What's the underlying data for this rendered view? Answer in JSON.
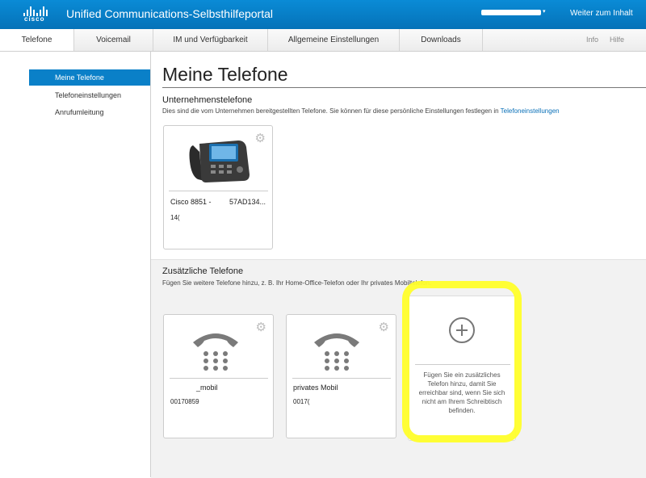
{
  "header": {
    "brand": "cisco",
    "title": "Unified Communications-Selbsthilfeportal",
    "user_caret": "▾",
    "skip_link": "Weiter zum Inhalt"
  },
  "tabs": [
    "Telefone",
    "Voicemail",
    "IM und Verfügbarkeit",
    "Allgemeine Einstellungen",
    "Downloads"
  ],
  "top_links": {
    "info": "Info",
    "help": "Hilfe"
  },
  "sidebar": {
    "items": [
      "Meine Telefone",
      "Telefoneinstellungen",
      "Anrufumleitung"
    ]
  },
  "main": {
    "title": "Meine Telefone",
    "company_section": {
      "title": "Unternehmenstelefone",
      "description": "Dies sind die vom Unternehmen bereitgestellten Telefone. Sie können für diese persönliche Einstellungen festlegen in",
      "link": "Telefoneinstellungen",
      "phones": [
        {
          "name": "Cisco 8851 -",
          "name_suffix": "57AD134...",
          "number": "14("
        }
      ]
    },
    "additional_section": {
      "title": "Zusätzliche Telefone",
      "description": "Fügen Sie weitere Telefone hinzu, z. B. Ihr Home-Office-Telefon oder Ihr privates Mobiltelefon.",
      "phones": [
        {
          "name": "_mobil",
          "number": "00170859"
        },
        {
          "name": "privates Mobil",
          "number": "0017("
        }
      ],
      "add_card_text": "Fügen Sie ein zusätzliches Telefon hinzu, damit Sie erreichbar sind, wenn Sie sich nicht am Ihrem Schreibtisch befinden."
    }
  },
  "icons": {
    "gear": "gear-icon",
    "phone": "desk-phone-icon",
    "handset": "handset-keypad-icon",
    "add": "plus-circle-icon"
  },
  "colors": {
    "header_blue": "#0572b8",
    "active_blue": "#0a80c8",
    "link_blue": "#0a70b8",
    "highlight_yellow": "#fffe2a"
  }
}
